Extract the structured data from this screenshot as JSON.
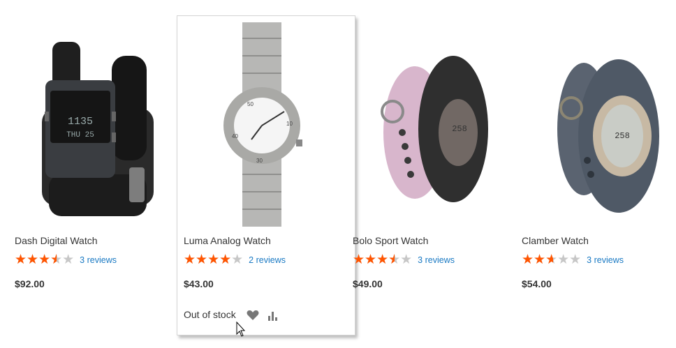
{
  "products": [
    {
      "name": "Dash Digital Watch",
      "rating_percent": 70,
      "reviews": "3 reviews",
      "price": "$92.00",
      "image_icon": "digital-watch-image"
    },
    {
      "name": "Luma Analog Watch",
      "rating_percent": 80,
      "reviews": "2 reviews",
      "price": "$43.00",
      "image_icon": "analog-watch-image"
    },
    {
      "name": "Bolo Sport Watch",
      "rating_percent": 70,
      "reviews": "3 reviews",
      "price": "$49.00",
      "image_icon": "sport-watch-image"
    },
    {
      "name": "Clamber Watch",
      "rating_percent": 53,
      "reviews": "3 reviews",
      "price": "$54.00",
      "image_icon": "clamber-watch-image"
    }
  ],
  "hover_actions": {
    "stock_text": "Out of stock",
    "wishlist_icon": "heart-icon",
    "compare_icon": "compare-bars-icon"
  },
  "colors": {
    "star_fill": "#ff5501",
    "star_empty": "#c7c7c7",
    "link": "#1979c3"
  }
}
